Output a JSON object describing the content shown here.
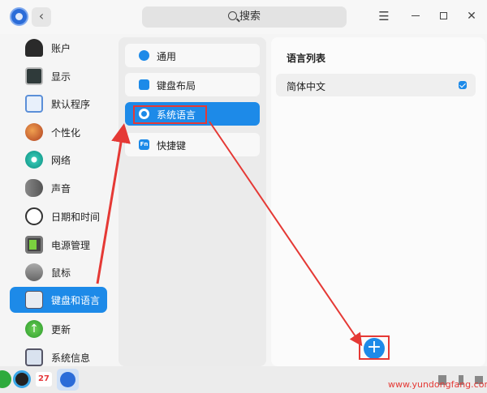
{
  "header": {
    "search_label": "搜索",
    "menu_glyph": "☰",
    "close_glyph": "✕",
    "back_glyph": "‹"
  },
  "sidebar": {
    "items": [
      {
        "label": "账户",
        "icon": "account-icon"
      },
      {
        "label": "显示",
        "icon": "display-icon"
      },
      {
        "label": "默认程序",
        "icon": "default-apps-icon"
      },
      {
        "label": "个性化",
        "icon": "personalization-icon"
      },
      {
        "label": "网络",
        "icon": "network-icon"
      },
      {
        "label": "声音",
        "icon": "sound-icon"
      },
      {
        "label": "日期和时间",
        "icon": "clock-icon"
      },
      {
        "label": "电源管理",
        "icon": "battery-icon"
      },
      {
        "label": "鼠标",
        "icon": "mouse-icon"
      },
      {
        "label": "键盘和语言",
        "icon": "keyboard-icon"
      },
      {
        "label": "更新",
        "icon": "update-icon"
      },
      {
        "label": "系统信息",
        "icon": "system-info-icon"
      }
    ],
    "active": "键盘和语言"
  },
  "submenu": {
    "items": [
      {
        "label": "通用",
        "icon": "gear-icon"
      },
      {
        "label": "键盘布局",
        "icon": "keyboard-layout-icon"
      },
      {
        "label": "系统语言",
        "icon": "globe-icon"
      },
      {
        "label": "快捷键",
        "icon": "fn-key-icon",
        "glyph": "Fn"
      }
    ],
    "active": "系统语言"
  },
  "content": {
    "title": "语言列表",
    "languages": [
      {
        "label": "简体中文",
        "checked": true
      }
    ],
    "add_glyph": "+"
  },
  "taskbar": {
    "calendar_day": "27",
    "watermark": "www.yundongfang.com"
  },
  "colors": {
    "accent": "#1d8ae8",
    "annotation": "#e53935"
  }
}
